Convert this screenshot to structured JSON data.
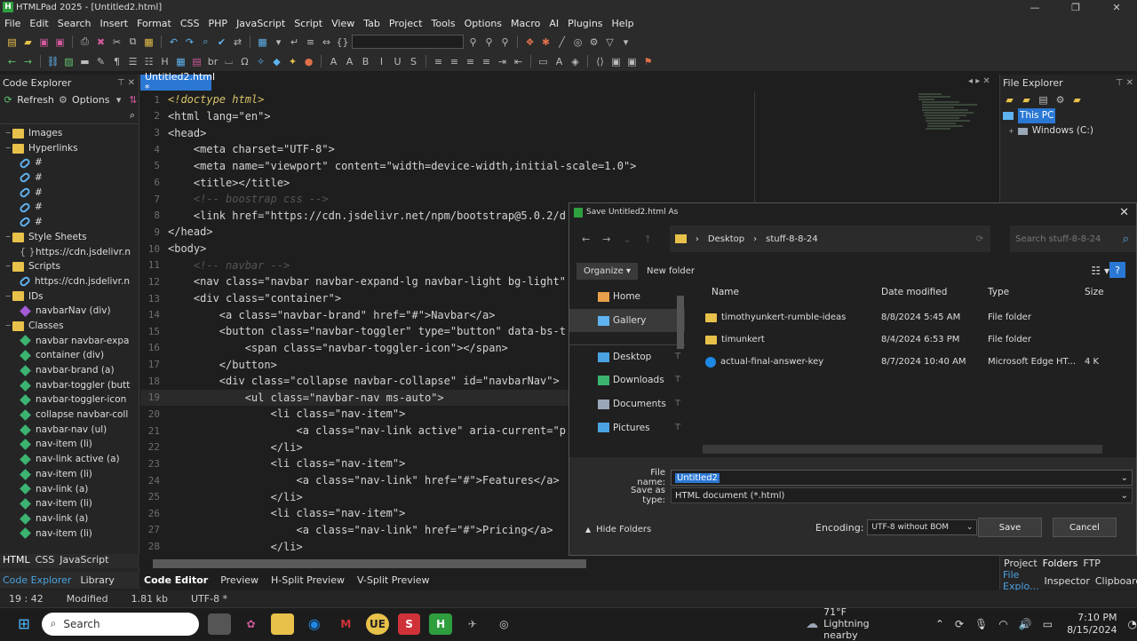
{
  "app": {
    "title": "HTMLPad 2025 - [Untitled2.html]"
  },
  "menu": [
    "File",
    "Edit",
    "Search",
    "Insert",
    "Format",
    "CSS",
    "PHP",
    "JavaScript",
    "Script",
    "View",
    "Tab",
    "Project",
    "Tools",
    "Options",
    "Macro",
    "AI",
    "Plugins",
    "Help"
  ],
  "left_panel": {
    "title": "Code Explorer",
    "refresh": "Refresh",
    "options": "Options",
    "tree": [
      {
        "level": 0,
        "kind": "folder",
        "label": "Images"
      },
      {
        "level": 0,
        "kind": "folder",
        "label": "Hyperlinks"
      },
      {
        "level": 1,
        "kind": "link",
        "label": "#"
      },
      {
        "level": 1,
        "kind": "link",
        "label": "#"
      },
      {
        "level": 1,
        "kind": "link",
        "label": "#"
      },
      {
        "level": 1,
        "kind": "link",
        "label": "#"
      },
      {
        "level": 1,
        "kind": "link",
        "label": "#"
      },
      {
        "level": 0,
        "kind": "folder",
        "label": "Style Sheets"
      },
      {
        "level": 1,
        "kind": "brace",
        "label": "https://cdn.jsdelivr.n"
      },
      {
        "level": 0,
        "kind": "folder",
        "label": "Scripts"
      },
      {
        "level": 1,
        "kind": "link",
        "label": "https://cdn.jsdelivr.n"
      },
      {
        "level": 0,
        "kind": "folder",
        "label": "IDs"
      },
      {
        "level": 1,
        "kind": "id",
        "label": "navbarNav (div)"
      },
      {
        "level": 0,
        "kind": "folder",
        "label": "Classes"
      },
      {
        "level": 1,
        "kind": "cls",
        "label": "navbar navbar-expa"
      },
      {
        "level": 1,
        "kind": "cls",
        "label": "container (div)"
      },
      {
        "level": 1,
        "kind": "cls",
        "label": "navbar-brand (a)"
      },
      {
        "level": 1,
        "kind": "cls",
        "label": "navbar-toggler (butt"
      },
      {
        "level": 1,
        "kind": "cls",
        "label": "navbar-toggler-icon"
      },
      {
        "level": 1,
        "kind": "cls",
        "label": "collapse navbar-coll"
      },
      {
        "level": 1,
        "kind": "cls",
        "label": "navbar-nav (ul)"
      },
      {
        "level": 1,
        "kind": "cls",
        "label": "nav-item (li)"
      },
      {
        "level": 1,
        "kind": "cls",
        "label": "nav-link active (a)"
      },
      {
        "level": 1,
        "kind": "cls",
        "label": "nav-item (li)"
      },
      {
        "level": 1,
        "kind": "cls",
        "label": "nav-link (a)"
      },
      {
        "level": 1,
        "kind": "cls",
        "label": "nav-item (li)"
      },
      {
        "level": 1,
        "kind": "cls",
        "label": "nav-link (a)"
      },
      {
        "level": 1,
        "kind": "cls",
        "label": "nav-item (li)"
      }
    ],
    "lang_tabs": [
      "HTML",
      "CSS",
      "JavaScript"
    ],
    "bottom_tabs": [
      "Code Explorer",
      "Library"
    ]
  },
  "editor": {
    "tab": "Untitled2.html *",
    "lines": [
      {
        "n": "1",
        "t": "<!doctype html>",
        "c": "dt"
      },
      {
        "n": "2",
        "t": "<html lang=\"en\">",
        "c": ""
      },
      {
        "n": "3",
        "t": "<head>",
        "c": ""
      },
      {
        "n": "4",
        "t": "    <meta charset=\"UTF-8\">",
        "c": ""
      },
      {
        "n": "5",
        "t": "    <meta name=\"viewport\" content=\"width=device-width,initial-scale=1.0\">",
        "c": ""
      },
      {
        "n": "6",
        "t": "    <title></title>",
        "c": ""
      },
      {
        "n": "7",
        "t": "    <!-- boostrap css -->",
        "c": "cm"
      },
      {
        "n": "8",
        "t": "    <link href=\"https://cdn.jsdelivr.net/npm/bootstrap@5.0.2/d",
        "c": ""
      },
      {
        "n": "9",
        "t": "</head>",
        "c": ""
      },
      {
        "n": "10",
        "t": "<body>",
        "c": ""
      },
      {
        "n": "11",
        "t": "    <!-- navbar -->",
        "c": "cm"
      },
      {
        "n": "12",
        "t": "    <nav class=\"navbar navbar-expand-lg navbar-light bg-light\"",
        "c": ""
      },
      {
        "n": "13",
        "t": "    <div class=\"container\">",
        "c": ""
      },
      {
        "n": "14",
        "t": "        <a class=\"navbar-brand\" href=\"#\">Navbar</a>",
        "c": ""
      },
      {
        "n": "15",
        "t": "        <button class=\"navbar-toggler\" type=\"button\" data-bs-t",
        "c": ""
      },
      {
        "n": "16",
        "t": "            <span class=\"navbar-toggler-icon\"></span>",
        "c": ""
      },
      {
        "n": "17",
        "t": "        </button>",
        "c": ""
      },
      {
        "n": "18",
        "t": "        <div class=\"collapse navbar-collapse\" id=\"navbarNav\">",
        "c": ""
      },
      {
        "n": "19",
        "t": "            <ul class=\"navbar-nav ms-auto\">",
        "c": "hl"
      },
      {
        "n": "20",
        "t": "                <li class=\"nav-item\">",
        "c": ""
      },
      {
        "n": "21",
        "t": "                    <a class=\"nav-link active\" aria-current=\"p",
        "c": ""
      },
      {
        "n": "22",
        "t": "                </li>",
        "c": ""
      },
      {
        "n": "23",
        "t": "                <li class=\"nav-item\">",
        "c": ""
      },
      {
        "n": "24",
        "t": "                    <a class=\"nav-link\" href=\"#\">Features</a>",
        "c": ""
      },
      {
        "n": "25",
        "t": "                </li>",
        "c": ""
      },
      {
        "n": "26",
        "t": "                <li class=\"nav-item\">",
        "c": ""
      },
      {
        "n": "27",
        "t": "                    <a class=\"nav-link\" href=\"#\">Pricing</a>",
        "c": ""
      },
      {
        "n": "28",
        "t": "                </li>",
        "c": ""
      }
    ],
    "view_tabs": [
      "Code Editor",
      "Preview",
      "H-Split Preview",
      "V-Split Preview"
    ]
  },
  "right_panel": {
    "title": "File Explorer",
    "tree": [
      "This PC",
      "Windows (C:)"
    ],
    "tabs1": [
      "Project",
      "Folders",
      "FTP"
    ],
    "tabs2": [
      "File Explo...",
      "Inspector",
      "Clipboard"
    ]
  },
  "status": {
    "pos": "19 : 42",
    "state": "Modified",
    "size": "1.81 kb",
    "enc": "UTF-8 *"
  },
  "dialog": {
    "title": "Save Untitled2.html As",
    "crumbs": [
      "Desktop",
      "stuff-8-8-24"
    ],
    "search_placeholder": "Search stuff-8-8-24",
    "organize": "Organize",
    "new_folder": "New folder",
    "nav": [
      {
        "label": "Home",
        "color": "#e8a04a"
      },
      {
        "label": "Gallery",
        "color": "#5fb3f0",
        "sel": true
      },
      {
        "label": "Desktop",
        "color": "#4aa3e0"
      },
      {
        "label": "Downloads",
        "color": "#3cb371"
      },
      {
        "label": "Documents",
        "color": "#9aa7b8"
      },
      {
        "label": "Pictures",
        "color": "#4aa3e0"
      }
    ],
    "headers": {
      "name": "Name",
      "date": "Date modified",
      "type": "Type",
      "size": "Size"
    },
    "files": [
      {
        "name": "timothyunkert-rumble-ideas",
        "date": "8/8/2024 5:45 AM",
        "type": "File folder",
        "size": "",
        "kind": "folder"
      },
      {
        "name": "timunkert",
        "date": "8/4/2024 6:53 PM",
        "type": "File folder",
        "size": "",
        "kind": "folder"
      },
      {
        "name": "actual-final-answer-key",
        "date": "8/7/2024 10:40 AM",
        "type": "Microsoft Edge HT...",
        "size": "4 K",
        "kind": "edge"
      }
    ],
    "file_name_label": "File name:",
    "file_name": "Untitled2",
    "type_label": "Save as type:",
    "save_type": "HTML document (*.html)",
    "hide_folders": "Hide Folders",
    "encoding_label": "Encoding:",
    "encoding": "UTF-8 without BOM",
    "save": "Save",
    "cancel": "Cancel"
  },
  "taskbar": {
    "search": "Search",
    "weather_temp": "71°F",
    "weather_desc": "Lightning nearby",
    "time": "7:10 PM",
    "date": "8/15/2024"
  }
}
